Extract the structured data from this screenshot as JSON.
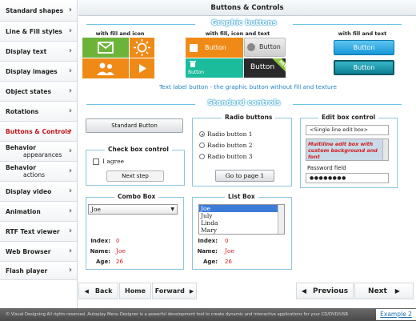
{
  "title": "Buttons & Controls",
  "sidebar": {
    "items": [
      {
        "label": "Standard shapes"
      },
      {
        "label": "Line & Fill styles"
      },
      {
        "label": "Display text"
      },
      {
        "label": "Display images"
      },
      {
        "label": "Object states"
      },
      {
        "label": "Rotations"
      },
      {
        "label": "Buttons & Controls"
      },
      {
        "label": "Behavior",
        "sub": "appearances"
      },
      {
        "label": "Behavior",
        "sub": "actions"
      },
      {
        "label": "Display video"
      },
      {
        "label": "Animation"
      },
      {
        "label": "RTF Text viewer"
      },
      {
        "label": "Web Browser"
      },
      {
        "label": "Flash player"
      }
    ]
  },
  "graphic": {
    "heading": "Graphic buttons",
    "label_fill_icon": "with fill and icon",
    "label_fill_icon_text": "with fill, icon and text",
    "label_fill_text": "with fill and text",
    "btn_label": "Button",
    "new_badge": "NEW",
    "text_label": "Text label button - the graphic button without fill and texture",
    "colors": {
      "green": "#6cb33a",
      "orange": "#ef8a17",
      "blue": "#2aa4da",
      "teal": "#1abc9c",
      "dark": "#2a2a2a"
    }
  },
  "standard": {
    "heading": "Standard controls",
    "standard_button": "Standard Button",
    "checkbox_group": "Check box control",
    "checkbox_label": "I agree",
    "next_step": "Next step",
    "radio_group": "Radio buttons",
    "radios": [
      "Radio button 1",
      "Radio button 2",
      "Radio button 3"
    ],
    "goto_page": "Go to page 1",
    "editbox_group": "Edit box control",
    "single_line": "<Single line edit box>",
    "multiline": "Multiline edit box with custom background and font",
    "password_label": "Password field",
    "password_value": "●●●●●●●●"
  },
  "combo": {
    "heading": "Combo Box",
    "selected": "Joe",
    "index_label": "Index:",
    "index_value": "0",
    "name_label": "Name:",
    "name_value": "Joe",
    "age_label": "Age:",
    "age_value": "26"
  },
  "list": {
    "heading": "List Box",
    "items": [
      "Joe",
      "July",
      "Linda",
      "Mary"
    ],
    "index_label": "Index:",
    "index_value": "0",
    "name_label": "Name:",
    "name_value": "Joe",
    "age_label": "Age:",
    "age_value": "26"
  },
  "nav": {
    "back": "Back",
    "home": "Home",
    "forward": "Forward",
    "previous": "Previous",
    "next": "Next"
  },
  "footer": {
    "text": "© Visual Designing All rights reserved. Autoplay Menu Designer is a powerful development tool to create dynamic and interactive applications for your CD/DVD/USB",
    "link": "Example 2"
  }
}
